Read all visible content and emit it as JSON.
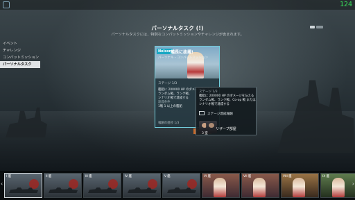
{
  "topbar": {
    "fps": "124",
    "logo_icon": "ship-wheel-icon"
  },
  "header": {
    "title": "パーソナルタスク (!)",
    "subtitle": "パーソナルタスクには、特別なコンパットミッションやチャレンジが含まれます。"
  },
  "sidebar": {
    "items": [
      {
        "label": "イベント",
        "active": false
      },
      {
        "label": "チャレンジ",
        "active": false
      },
      {
        "label": "コンバットミッション",
        "active": false
      },
      {
        "label": "パーソナルタスク",
        "active": true
      }
    ]
  },
  "task_card": {
    "badge": "Nelson",
    "title": "艦長に抜擢!",
    "subtitle": "パーソナル・コンバットミッション",
    "stage": "ステージ 1/3",
    "body": "艦艇に 200000 HP のダメージを与える\nランダム戦、ランク戦、\nシナリオ戦で達成する",
    "conditions_label": "達成条件",
    "conditions": "1戦 1 以上の艦船",
    "footer": "報酬の進捗 1/3",
    "button": "スタート"
  },
  "tooltip": {
    "stage": "ステージ 1/3",
    "body": "艦艇に 200000 HP のダメージを与える\nランダム戦、ランク戦、Co-op 戦 または\nシナリオ戦で達成する",
    "reward_label": "ステージ達成報酬",
    "reserve_label": "リザーブ部屋",
    "quantity": "3 室"
  },
  "carousel": {
    "left_arrow": "‹",
    "right_arrow": "›",
    "ships": [
      {
        "name": "I 艦",
        "style": "gray",
        "selected": true
      },
      {
        "name": "II 艦",
        "style": "gray",
        "selected": false
      },
      {
        "name": "III 艦",
        "style": "gray",
        "selected": false
      },
      {
        "name": "IV 艦",
        "style": "gray",
        "selected": false
      },
      {
        "name": "V 艦",
        "style": "gray",
        "selected": false
      },
      {
        "name": "VI 艦",
        "style": "art",
        "selected": false
      },
      {
        "name": "VII 艦",
        "style": "art",
        "selected": false
      },
      {
        "name": "VIII 艦",
        "style": "art gold",
        "selected": false
      },
      {
        "name": "IX 艦",
        "style": "art green",
        "selected": false
      }
    ]
  },
  "colors": {
    "accent": "#73d0de",
    "fps": "#38e05a",
    "start_button": "#c96a2a"
  }
}
